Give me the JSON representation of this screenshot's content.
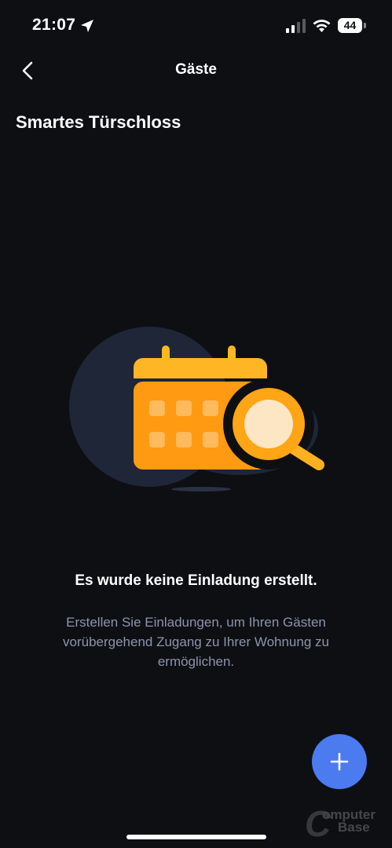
{
  "status_bar": {
    "time": "21:07",
    "battery": "44"
  },
  "nav": {
    "title": "Gäste",
    "back_icon": "chevron-left-icon"
  },
  "section": {
    "title": "Smartes Türschloss"
  },
  "empty_state": {
    "illustration": "calendar-search-illustration",
    "title": "Es wurde keine Einladung erstellt.",
    "description": "Erstellen Sie Einladungen, um Ihren Gästen vorübergehend Zugang zu Ihrer Wohnung zu ermöglichen."
  },
  "fab": {
    "icon": "plus-icon",
    "color": "#4c7bf0"
  },
  "watermark": {
    "line1": "omputer",
    "line2": "ase",
    "letter1": "C",
    "letter2": "B"
  },
  "colors": {
    "background": "#0e0f13",
    "accent_orange": "#ffb020",
    "muted_text": "#8d94ad"
  }
}
